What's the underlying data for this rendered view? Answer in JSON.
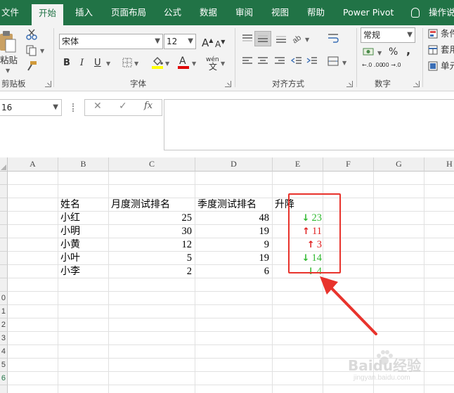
{
  "ribbon_tabs": [
    "文件",
    "开始",
    "插入",
    "页面布局",
    "公式",
    "数据",
    "审阅",
    "视图",
    "帮助",
    "Power Pivot",
    "操作说"
  ],
  "active_tab": "开始",
  "clipboard": {
    "paste_label": "粘贴",
    "group_label": "剪贴板"
  },
  "font": {
    "name": "宋体",
    "size": "12",
    "grow": "A",
    "shrink": "A",
    "bold": "B",
    "italic": "I",
    "underline": "U",
    "phonetic": "wén",
    "font_color_letter": "A",
    "group_label": "字体"
  },
  "alignment": {
    "group_label": "对齐方式"
  },
  "number": {
    "format": "常规",
    "percent": "%",
    "comma": ",",
    "inc_decimal": "←.0 .00",
    "dec_decimal": ".00 →.0",
    "group_label": "数字"
  },
  "styles": {
    "items": [
      "条件",
      "套用",
      "单元"
    ]
  },
  "formula_bar": {
    "name_box": "16",
    "cancel": "✕",
    "enter": "✓",
    "fx": "fx",
    "content": ""
  },
  "columns": [
    "A",
    "B",
    "C",
    "D",
    "E",
    "F",
    "G",
    "H"
  ],
  "row_numbers": [
    "",
    "",
    "",
    "",
    "",
    "",
    "",
    "",
    "",
    "0",
    "1",
    "2",
    "3",
    "4",
    "5",
    "6",
    ""
  ],
  "table": {
    "headers": [
      "姓名",
      "月度测试排名",
      "季度测试排名",
      "升降"
    ],
    "rows": [
      {
        "name": "小红",
        "monthly": "25",
        "quarterly": "48",
        "arrow": "↓",
        "change": "23",
        "color": "#2fb82f"
      },
      {
        "name": "小明",
        "monthly": "30",
        "quarterly": "19",
        "arrow": "↑",
        "change": "11",
        "color": "#e02020"
      },
      {
        "name": "小黄",
        "monthly": "12",
        "quarterly": "9",
        "arrow": "↑",
        "change": "3",
        "color": "#e02020"
      },
      {
        "name": "小叶",
        "monthly": "5",
        "quarterly": "19",
        "arrow": "↓",
        "change": "14",
        "color": "#2fb82f"
      },
      {
        "name": "小李",
        "monthly": "2",
        "quarterly": "6",
        "arrow": "↓",
        "change": "4",
        "color": "#2fb82f"
      }
    ]
  },
  "colors": {
    "excel_green": "#217346",
    "annotation_red": "#e8332c",
    "font_color_red": "#e00000",
    "fill_yellow": "#ffff00"
  },
  "watermark": {
    "text": "Baidu经验",
    "sub": "jingyan.baidu.com"
  }
}
